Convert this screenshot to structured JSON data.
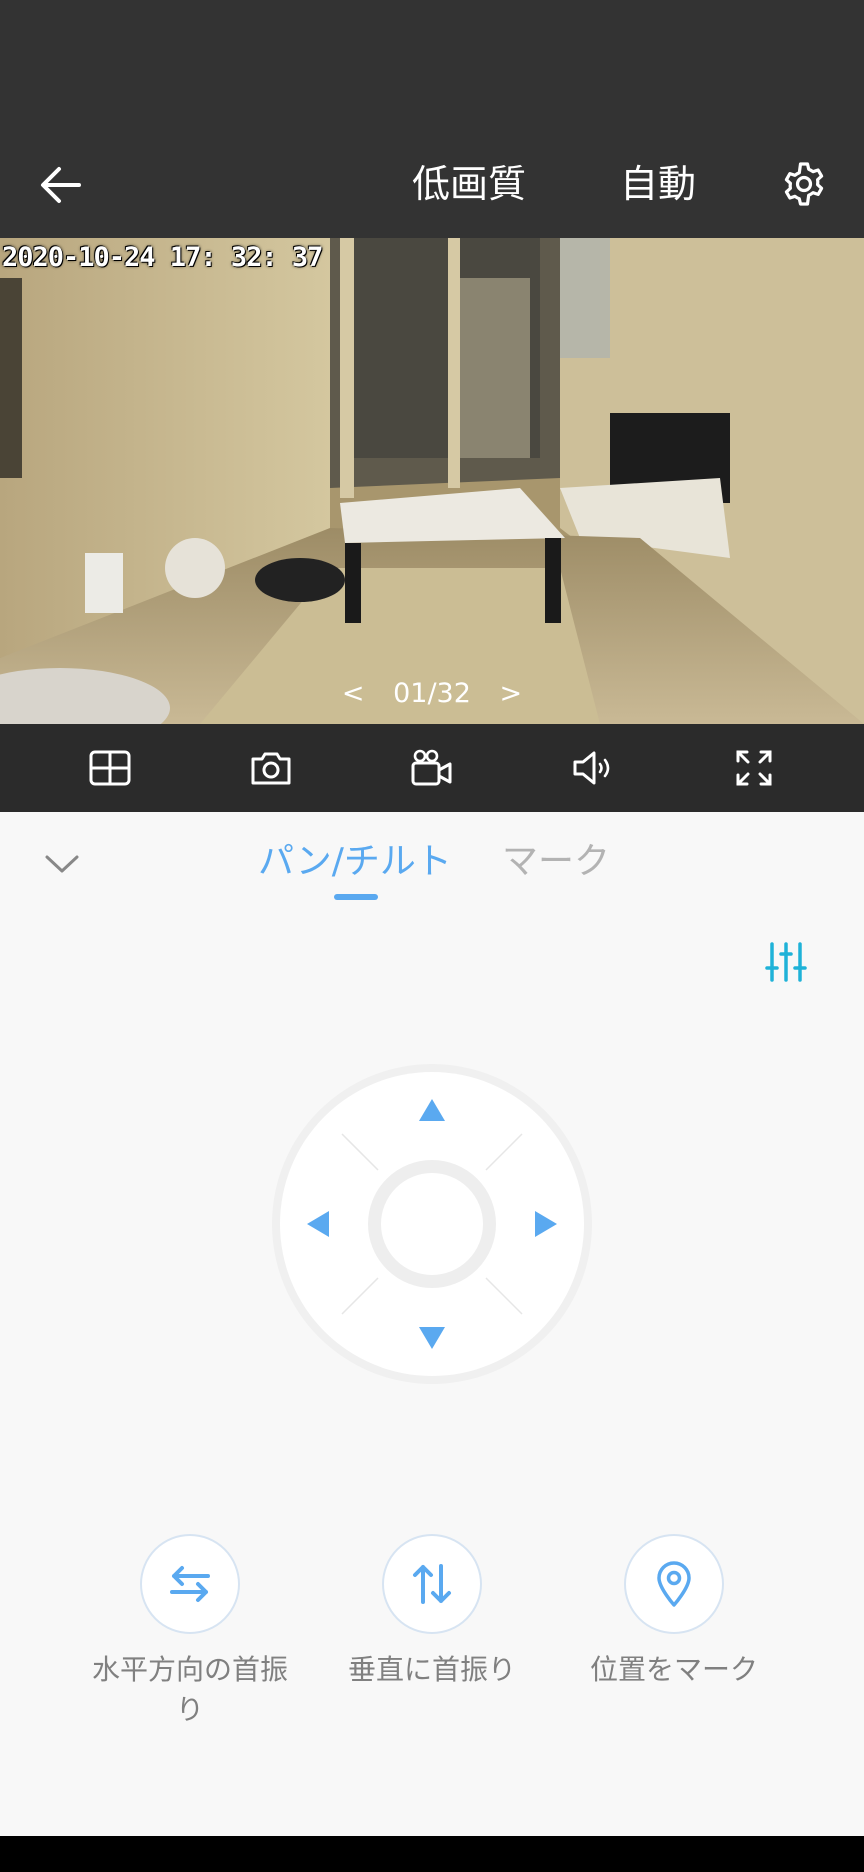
{
  "header": {
    "quality_label": "低画質",
    "mode_label": "自動"
  },
  "video": {
    "timestamp": "2020-10-24  17: 32: 37",
    "pager": {
      "prev": "<",
      "current": "01/32",
      "next": ">"
    }
  },
  "toolbar": {
    "icons": [
      "grid-icon",
      "camera-icon",
      "video-record-icon",
      "speaker-icon",
      "fullscreen-icon"
    ]
  },
  "tabs": [
    {
      "label": "パン/チルト",
      "active": true
    },
    {
      "label": "マーク",
      "active": false
    }
  ],
  "actions": [
    {
      "label": "水平方向の首振り",
      "icon": "horizontal-swap-icon"
    },
    {
      "label": "垂直に首振り",
      "icon": "vertical-swap-icon"
    },
    {
      "label": "位置をマーク",
      "icon": "location-pin-icon"
    }
  ],
  "colors": {
    "accent": "#5aa9f0",
    "bar": "#333333",
    "toolbar": "#2b2b2b",
    "panel": "#f8f8f8"
  }
}
